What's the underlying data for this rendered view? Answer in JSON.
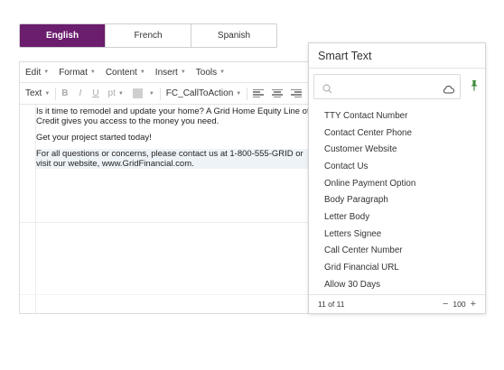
{
  "language_tabs": [
    {
      "label": "English",
      "active": true
    },
    {
      "label": "French",
      "active": false
    },
    {
      "label": "Spanish",
      "active": false
    }
  ],
  "menubar": {
    "items": [
      "Edit",
      "Format",
      "Content",
      "Insert",
      "Tools"
    ]
  },
  "toolbar": {
    "text_style": "Text",
    "bold": "B",
    "italic": "I",
    "underline": "U",
    "font_size": "pt",
    "style_select": "FC_CallToAction"
  },
  "document": {
    "paragraphs": [
      "Is it time to remodel and update your home? A Grid Home Equity Line of Credit gives you access to the money you need.",
      "Get your project started today!",
      "For all questions or concerns, please contact us at 1-800-555-GRID or visit our website, www.GridFinancial.com."
    ]
  },
  "smart_text": {
    "title": "Smart Text",
    "search_placeholder": "",
    "items": [
      "TTY Contact Number",
      "Contact Center Phone",
      "Customer Website",
      "Contact Us",
      "Online Payment Option",
      "Body Paragraph",
      "Letter Body",
      "Letters Signee",
      "Call Center Number",
      "Grid Financial URL",
      "Allow 30 Days"
    ],
    "count_label": "11 of 11",
    "zoom_minus": "−",
    "zoom_value": "100",
    "zoom_plus": "+"
  },
  "colors": {
    "active_tab": "#6b1d6e",
    "pin": "#3c8a3c"
  },
  "icons": {
    "search": "search-icon",
    "cloud": "cloud-icon",
    "pin": "pin-icon"
  }
}
